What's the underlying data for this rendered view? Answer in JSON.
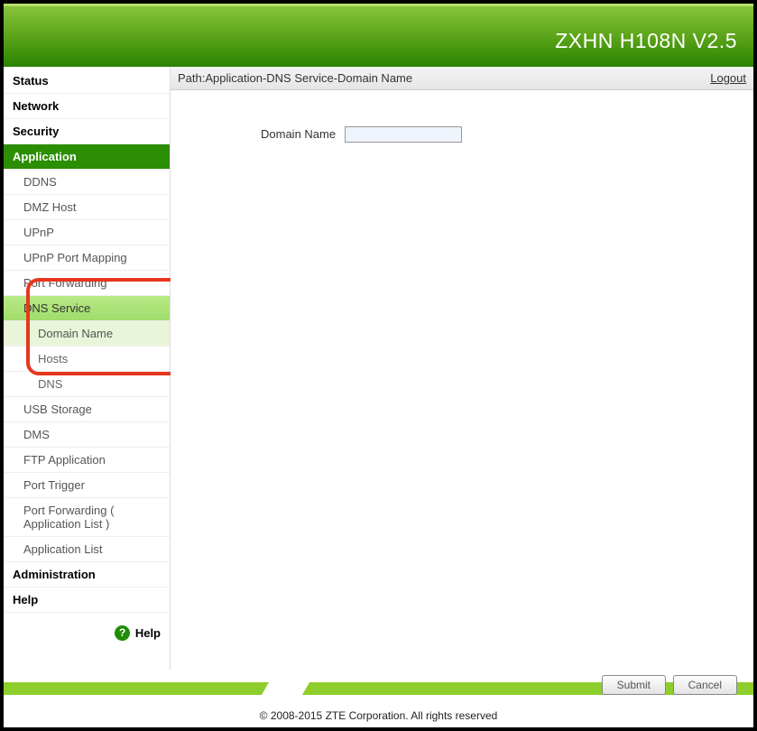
{
  "header": {
    "title": "ZXHN H108N V2.5"
  },
  "nav": {
    "status": "Status",
    "network": "Network",
    "security": "Security",
    "application": "Application",
    "ddns": "DDNS",
    "dmz": "DMZ Host",
    "upnp": "UPnP",
    "upnp_pm": "UPnP Port Mapping",
    "port_fwd": "Port Forwarding",
    "dns_service": "DNS Service",
    "domain_name": "Domain Name",
    "hosts": "Hosts",
    "dns": "DNS",
    "usb": "USB Storage",
    "dms": "DMS",
    "ftp": "FTP Application",
    "port_trigger": "Port Trigger",
    "port_fwd_list": "Port Forwarding ( Application List )",
    "app_list": "Application List",
    "administration": "Administration",
    "help": "Help",
    "help_link": "Help"
  },
  "breadcrumb": {
    "path": "Path:Application-DNS Service-Domain Name",
    "logout": "Logout"
  },
  "form": {
    "domain_label": "Domain Name",
    "domain_value": ""
  },
  "buttons": {
    "submit": "Submit",
    "cancel": "Cancel"
  },
  "footer": {
    "copyright": "© 2008-2015 ZTE Corporation. All rights reserved"
  }
}
